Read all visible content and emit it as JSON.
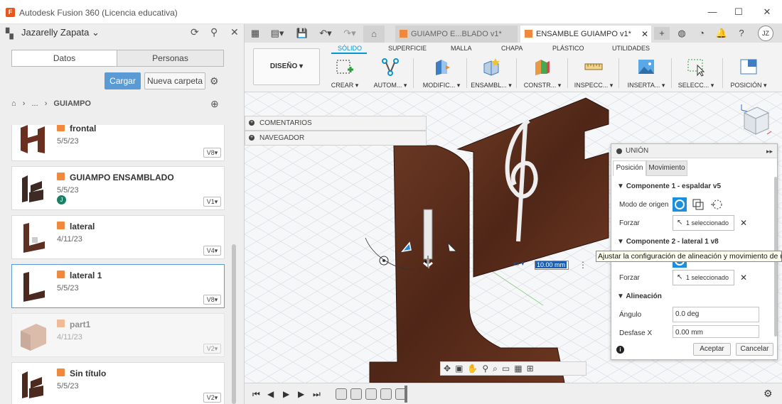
{
  "window": {
    "title": "Autodesk Fusion 360 (Licencia educativa)",
    "logo_letter": "F"
  },
  "data_panel": {
    "user": "Jazarelly Zapata",
    "tabs": [
      "Datos",
      "Personas"
    ],
    "upload_label": "Cargar",
    "new_folder_label": "Nueva carpeta",
    "breadcrumb": [
      "...",
      "GUIAMPO"
    ],
    "files": [
      {
        "name": "frontal",
        "date": "5/5/23",
        "version": "V8"
      },
      {
        "name": "GUIAMPO ENSAMBLADO",
        "date": "5/5/23",
        "version": "V1",
        "badge": "J"
      },
      {
        "name": "lateral",
        "date": "4/11/23",
        "version": "V4"
      },
      {
        "name": "lateral 1",
        "date": "5/5/23",
        "version": "V8"
      },
      {
        "name": "part1",
        "date": "4/11/23",
        "version": "V2"
      },
      {
        "name": "Sin título",
        "date": "5/5/23",
        "version": "V2"
      }
    ]
  },
  "tabs_bar": {
    "doc_tabs": [
      {
        "label": "GUIAMPO E...BLADO v1*",
        "active": false
      },
      {
        "label": "ENSAMBLE GUIAMPO v1*",
        "active": true
      }
    ],
    "user_initials": "JZ"
  },
  "toolbar": {
    "workspace": "DISEÑO ▾",
    "workspace_tabs": [
      "SÓLIDO",
      "SUPERFICIE",
      "MALLA",
      "CHAPA",
      "PLÁSTICO",
      "UTILIDADES"
    ],
    "tools": [
      {
        "label": "CREAR ▾"
      },
      {
        "label": "AUTOM... ▾"
      },
      {
        "label": "MODIFIC... ▾"
      },
      {
        "label": "ENSAMBL... ▾"
      },
      {
        "label": "CONSTR... ▾"
      },
      {
        "label": "INSPECC... ▾"
      },
      {
        "label": "INSERTA... ▾"
      },
      {
        "label": "SELECC... ▾"
      },
      {
        "label": "POSICIÓN ▾"
      }
    ]
  },
  "viewport": {
    "browser_panels": [
      "COMENTARIOS",
      "NAVEGADOR"
    ],
    "dimension_value": "10.00 mm"
  },
  "joint_dialog": {
    "title": "UNIÓN",
    "tabs": [
      "Posición",
      "Movimiento"
    ],
    "component1_header": "Componente 1 - espaldar v5",
    "component2_header": "Componente 2 - lateral 1 v8",
    "origin_mode_label": "Modo de origen",
    "snap_label": "Forzar",
    "selected_text": "1 seleccionado",
    "alignment_header": "Alineación",
    "angle_label": "Ángulo",
    "angle_value": "0.0 deg",
    "offset_x_label": "Desfase X",
    "offset_x_value": "0.00 mm",
    "ok_label": "Aceptar",
    "cancel_label": "Cancelar"
  },
  "tooltip": "Ajustar la configuración de alineación y movimiento de u",
  "colors": {
    "accent": "#0696d7",
    "primary_button": "#5b9bd5",
    "wood": "#5c2e1c",
    "file_cube": "#f0883e"
  }
}
